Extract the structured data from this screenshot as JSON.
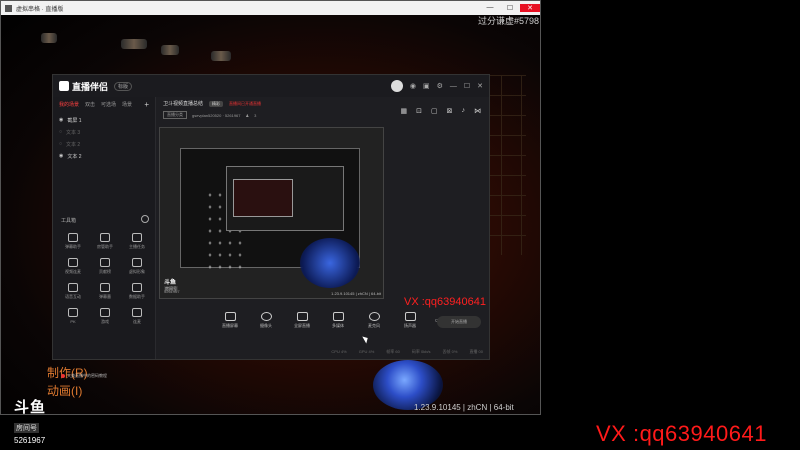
{
  "outer_window": {
    "title": "虚拟串格 · 直播版",
    "buttons": [
      "—",
      "☐",
      "✕"
    ]
  },
  "overlay": {
    "score": "过分谦虚#5798",
    "version": "1.23.9.10145 | zhCN | 64-bit",
    "vx_big": "VX :qq63940641",
    "vx_small": "VX :qq63940641",
    "side_labels": [
      "制作(R)",
      "动画(I)"
    ],
    "douyu_brand": "斗鱼",
    "douyu_sub": "房间号",
    "douyu_room": "5261967"
  },
  "app": {
    "brand": "直播伴侣",
    "version_pill": "标版",
    "top_icons": [
      "avatar",
      "broadcast-icon",
      "lock-icon",
      "settings-icon",
      "minimize-icon",
      "maximize-icon",
      "close-icon"
    ],
    "left": {
      "tabs": [
        "我的场景",
        "双击",
        "可选场",
        "场景"
      ],
      "add": "+",
      "sources": [
        {
          "label": "截屏 1",
          "dim": false
        },
        {
          "label": "文本 3",
          "dim": true
        },
        {
          "label": "文本 2",
          "dim": true
        },
        {
          "label": "文本 2",
          "dim": false
        }
      ],
      "tools_title": "工具箱",
      "tools": [
        "弹幕助手",
        "房管助手",
        "主播任务",
        "视频连麦",
        "贡献榜",
        "虚拟形象",
        "语音互动",
        "弹幕墨",
        "数据助手",
        "PK",
        "游戏",
        "连麦"
      ],
      "footer": "大美直播中的密码教程"
    },
    "main": {
      "title": "卫斗视频直播总结",
      "tag": "精彩",
      "red_note": "直播间已开通直播",
      "category": "直播分类",
      "sub_info": "gsevplan520520 · 5261967",
      "viewers": "3",
      "toolbar": [
        "直播屏幕",
        "摄像头",
        "全屏直播",
        "多媒体",
        "麦克风",
        "扬声器"
      ],
      "start_button": "开始直播",
      "status": [
        "CPU 4%",
        "GPU 4%",
        "帧率 60",
        "码率 0kb/s",
        "丢帧 0%",
        "直播 00"
      ],
      "preview_badge": "斗鱼",
      "preview_sub": "房间号",
      "preview_room": "5261967",
      "preview_version": "1.23.9.10145 | zhCN | 64-bit"
    }
  }
}
